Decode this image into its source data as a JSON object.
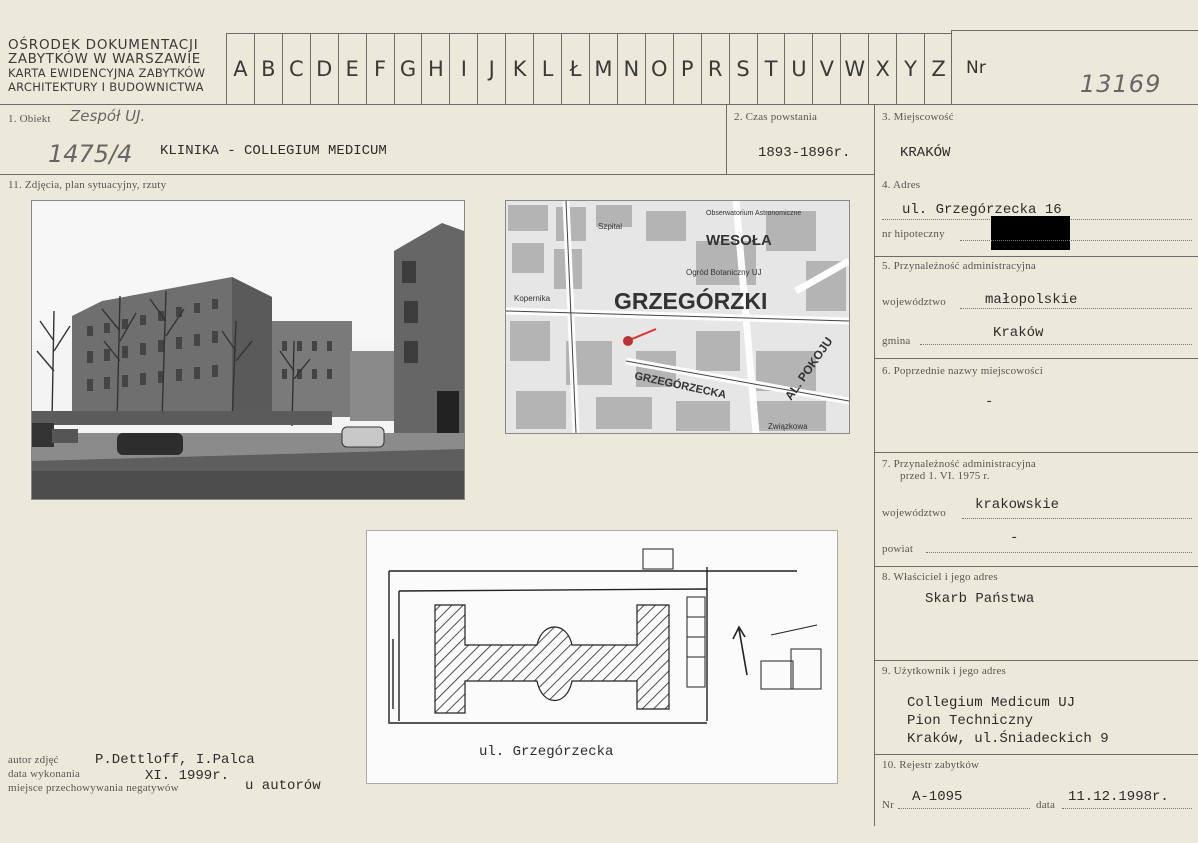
{
  "header": {
    "institution_lines": [
      "OŚRODEK DOKUMENTACJI",
      "ZABYTKÓW W WARSZAWIE",
      "KARTA EWIDENCYJNA ZABYTKÓW",
      "ARCHITEKTURY I BUDOWNICTWA"
    ],
    "letters": [
      "A",
      "B",
      "C",
      "D",
      "E",
      "F",
      "G",
      "H",
      "I",
      "J",
      "K",
      "L",
      "Ł",
      "M",
      "N",
      "O",
      "P",
      "R",
      "S",
      "T",
      "U",
      "V",
      "W",
      "X",
      "Y",
      "Z"
    ],
    "nr_label": "Nr",
    "nr_value": "13169"
  },
  "object": {
    "label": "1. Obiekt",
    "handwritten_note": "Zespół UJ.",
    "handwritten_code": "1475/4",
    "name": "KLINIKA  -  COLLEGIUM MEDICUM"
  },
  "date_created": {
    "label": "2. Czas powstania",
    "value": "1893-1896r."
  },
  "locality": {
    "label": "3. Miejscowość",
    "value": "KRAKÓW"
  },
  "photos_section": {
    "label": "11. Zdjęcia, plan sytuacyjny, rzuty"
  },
  "address": {
    "label": "4. Adres",
    "value": "ul. Grzegórzecka 16",
    "hipoteczny_label": "nr hipoteczny"
  },
  "admin": {
    "label": "5. Przynależność administracyjna",
    "woj_label": "województwo",
    "woj_value": "małopolskie",
    "gmina_label": "gmina",
    "gmina_value": "Kraków"
  },
  "previous_names": {
    "label": "6. Poprzednie nazwy miejscowości",
    "value": "-"
  },
  "admin_before": {
    "label_line1": "7. Przynależność administracyjna",
    "label_line2": "przed 1. VI. 1975 r.",
    "woj_label": "województwo",
    "woj_value": "krakowskie",
    "powiat_label": "powiat",
    "powiat_value": "-"
  },
  "owner": {
    "label": "8. Właściciel i jego adres",
    "value": "Skarb Państwa"
  },
  "user": {
    "label": "9. Użytkownik i jego adres",
    "lines": [
      "Collegium Medicum UJ",
      "Pion Techniczny",
      "Kraków, ul.Śniadeckich 9"
    ]
  },
  "register": {
    "label": "10. Rejestr zabytków",
    "nr_label": "Nr",
    "nr_value": "A-1095",
    "data_label": "data",
    "data_value": "11.12.1998r."
  },
  "footer": {
    "author_label": "autor zdjęć",
    "author_value": "P.Dettloff, I.Palca",
    "date_label": "data wykonania",
    "date_value": "XI. 1999r.",
    "storage_label": "miejsce przechowywania negatywów",
    "storage_value": "u autorów"
  },
  "map": {
    "district": "GRZEGÓRZKI",
    "streets": [
      "WESOŁA",
      "GRZEGÓRZECKA",
      "AL. POKOJU",
      "Ogród Botaniczny UJ",
      "Obserwatorium Astronomiczne",
      "Szpital",
      "Związkowa",
      "Kopernika"
    ]
  },
  "plan": {
    "street_label": "ul. Grzegórzecka"
  }
}
